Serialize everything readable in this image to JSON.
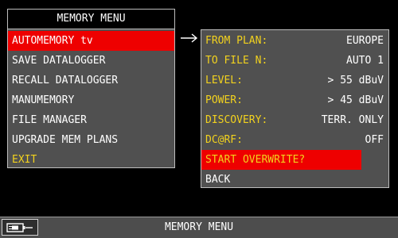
{
  "memory_menu": {
    "title": "MEMORY MENU",
    "items": [
      {
        "label": "AUTOMEMORY tv"
      },
      {
        "label": "SAVE DATALOGGER"
      },
      {
        "label": "RECALL DATALOGGER"
      },
      {
        "label": "MANUMEMORY"
      },
      {
        "label": "FILE MANAGER"
      },
      {
        "label": "UPGRADE MEM PLANS"
      },
      {
        "label": "EXIT"
      }
    ]
  },
  "settings": {
    "rows": [
      {
        "label": "FROM PLAN:",
        "value": "EUROPE"
      },
      {
        "label": "TO FILE N:",
        "value": "AUTO 1"
      },
      {
        "label": "LEVEL:",
        "value": "> 55 dBuV"
      },
      {
        "label": "POWER:",
        "value": "> 45 dBuV"
      },
      {
        "label": "DISCOVERY:",
        "value": "TERR. ONLY"
      },
      {
        "label": "DC@RF:",
        "value": "OFF"
      }
    ],
    "start_label": "START OVERWRITE?",
    "back_label": "BACK"
  },
  "status_bar": {
    "title": "MEMORY MENU"
  },
  "icons": {
    "connector": "right-arrow-icon",
    "power": "battery-plug-icon"
  },
  "colors": {
    "background": "#000000",
    "panel": "#505050",
    "selected": "#ee0000",
    "label_yellow": "#f2d21e",
    "text": "#ffffff"
  }
}
